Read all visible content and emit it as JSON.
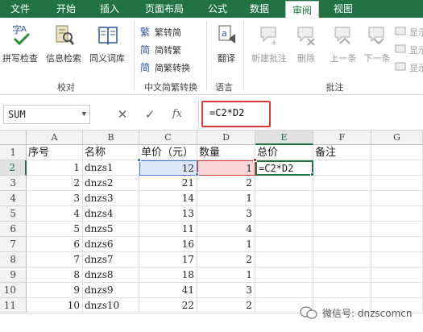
{
  "ribbon_tabs": [
    "文件",
    "开始",
    "插入",
    "页面布局",
    "公式",
    "数据",
    "审阅",
    "视图"
  ],
  "active_tab": "审阅",
  "groups": {
    "proofing": {
      "label": "校对",
      "buttons": [
        "拼写检查",
        "信息检索",
        "同义词库"
      ]
    },
    "chinese": {
      "label": "中文简繁转换",
      "buttons": [
        "繁转简",
        "简转繁",
        "简繁转换"
      ]
    },
    "language": {
      "label": "语言",
      "buttons": [
        "翻译"
      ]
    },
    "comments": {
      "label": "批注",
      "buttons": [
        "新建批注",
        "删除",
        "上一条",
        "下一条"
      ],
      "side": [
        "显示",
        "显示",
        "显示"
      ]
    }
  },
  "formula_bar": {
    "name_box": "SUM",
    "cancel_icon": "✕",
    "enter_icon": "✓",
    "fx_label": "fx",
    "formula": "=C2*D2"
  },
  "columns": [
    "A",
    "B",
    "C",
    "D",
    "E",
    "F",
    "G"
  ],
  "header_row": {
    "A": "序号",
    "B": "名称",
    "C": "单价（元）",
    "D": "数量",
    "E": "总价",
    "F": "备注"
  },
  "rows": [
    {
      "n": "1",
      "name": "dnzs1",
      "price": "12",
      "qty": "1"
    },
    {
      "n": "2",
      "name": "dnzs2",
      "price": "21",
      "qty": "2"
    },
    {
      "n": "3",
      "name": "dnzs3",
      "price": "14",
      "qty": "1"
    },
    {
      "n": "4",
      "name": "dnzs4",
      "price": "13",
      "qty": "3"
    },
    {
      "n": "5",
      "name": "dnzs5",
      "price": "11",
      "qty": "4"
    },
    {
      "n": "6",
      "name": "dnzs6",
      "price": "16",
      "qty": "1"
    },
    {
      "n": "7",
      "name": "dnzs7",
      "price": "17",
      "qty": "2"
    },
    {
      "n": "8",
      "name": "dnzs8",
      "price": "18",
      "qty": "1"
    },
    {
      "n": "9",
      "name": "dnzs9",
      "price": "41",
      "qty": "3"
    },
    {
      "n": "10",
      "name": "dnzs10",
      "price": "22",
      "qty": "2"
    }
  ],
  "row_numbers": [
    "1",
    "2",
    "3",
    "4",
    "5",
    "6",
    "7",
    "8",
    "9",
    "10",
    "11"
  ],
  "editing_cell_text": "=C2*D2",
  "watermark": "微信号: dnzscomcn",
  "colors": {
    "brand": "#217346",
    "ref_blue": "#4a78c8",
    "ref_red": "#d9363e"
  }
}
